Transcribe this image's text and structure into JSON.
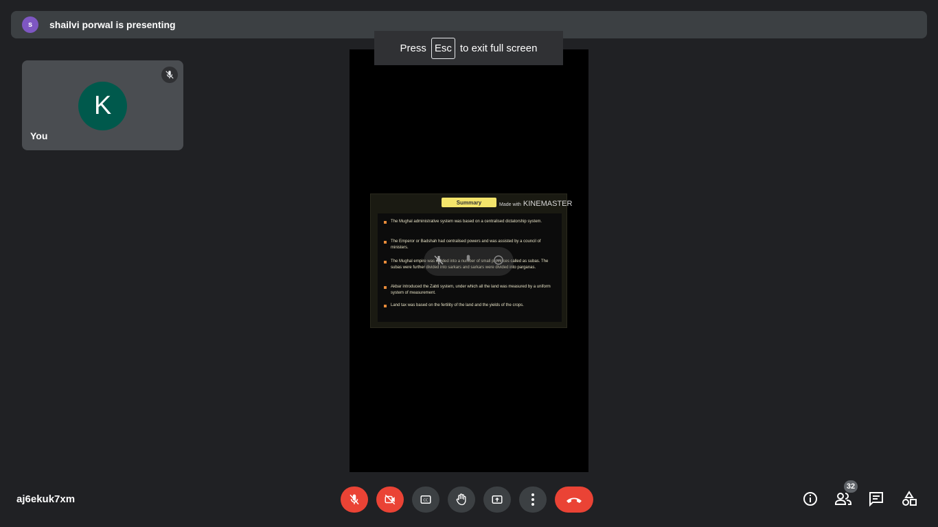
{
  "presenter": {
    "initial": "s",
    "text": "shailvi porwal is presenting"
  },
  "fullscreen_hint": {
    "before": "Press",
    "key": "Esc",
    "after": "to exit full screen"
  },
  "self_tile": {
    "initial": "K",
    "name": "You"
  },
  "slide": {
    "title": "Summary",
    "watermark_prefix": "Made with",
    "watermark": "KINEMASTER",
    "bullets": [
      "The Mughal administrative system was based on a centralised dictatorship system.",
      "The Emperor or Badshah had centralised powers and was assisted by a council of ministers.",
      "The Mughal empire was divided into a number of small provinces called as subas. The subas were further divided into sarkars and sarkars were divided into parganas.",
      "Akbar introduced the Zabti system, under which all the land was measured by a uniform system of measurement.",
      "Land tax was based on the fertility of the land and the yields of the crops."
    ]
  },
  "meeting_code": "aj6ekuk7xm",
  "participants_count": "32",
  "colors": {
    "bg": "#202124",
    "tile": "#4a4d51",
    "red": "#ea4335",
    "avatar_k": "#00594c",
    "avatar_s": "#7e57c2"
  }
}
